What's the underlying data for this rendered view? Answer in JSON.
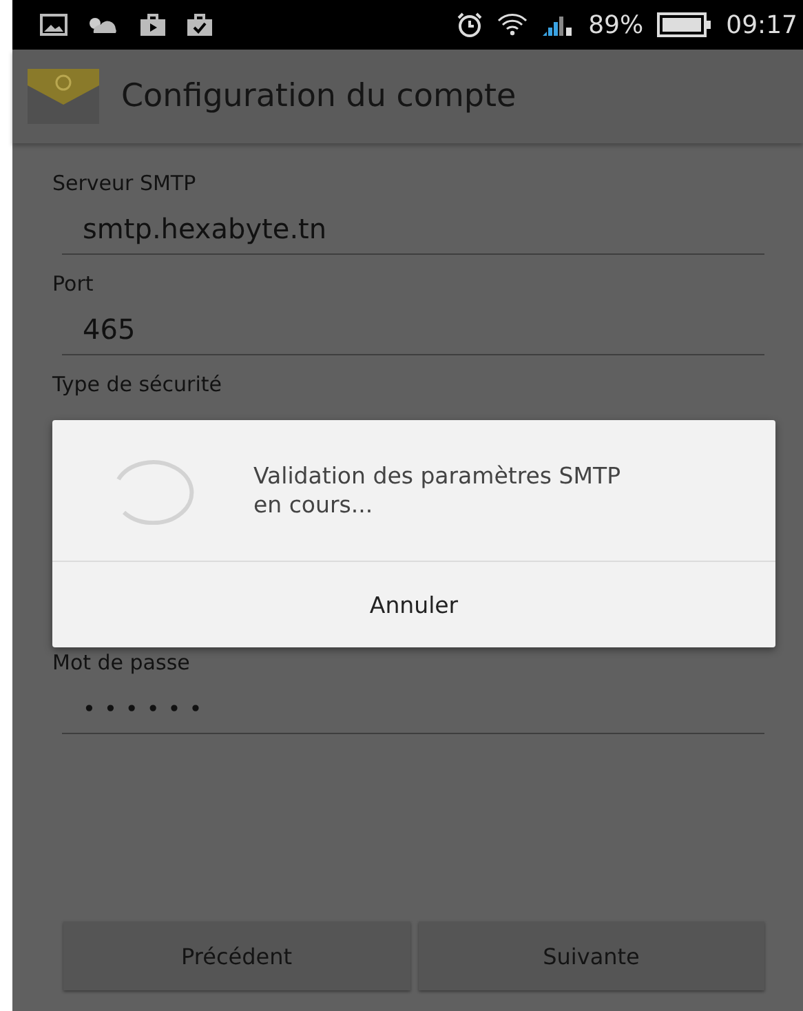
{
  "status_bar": {
    "battery": "89%",
    "time": "09:17"
  },
  "header": {
    "title": "Configuration du compte"
  },
  "fields": [
    {
      "label": "Serveur SMTP",
      "value": "smtp.hexabyte.tn",
      "kind": "text"
    },
    {
      "label": "Port",
      "value": "465",
      "kind": "text"
    },
    {
      "label": "Type de sécurité",
      "kind": "label"
    },
    {
      "label": "Mot de passe",
      "value": "••••••",
      "kind": "password"
    }
  ],
  "dialog": {
    "message": "Validation des paramètres SMTP en cours...",
    "button": "Annuler"
  },
  "buttons": [
    "Précédent",
    "Suivante"
  ]
}
